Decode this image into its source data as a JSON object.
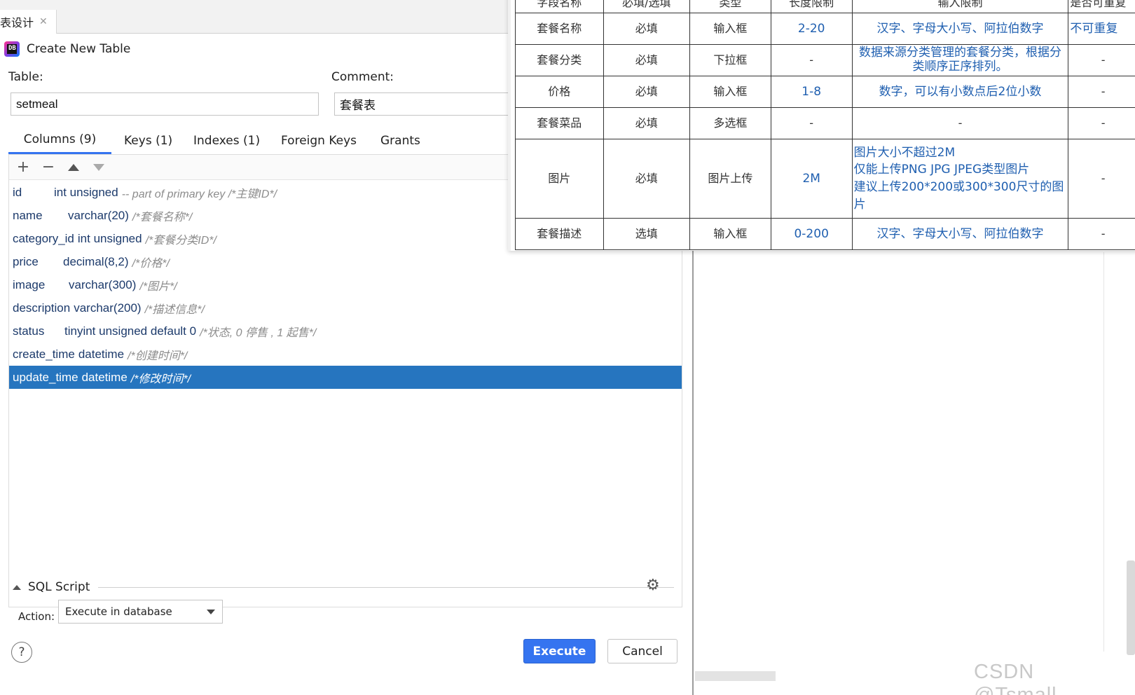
{
  "editor_tab": {
    "label": "表设计",
    "close": "✕"
  },
  "dialog": {
    "title": "Create New Table",
    "table_label": "Table:",
    "table_value": "setmeal",
    "comment_label": "Comment:",
    "comment_value": "套餐表",
    "tabs": [
      {
        "label": "Columns (9)",
        "active": true
      },
      {
        "label": "Keys (1)",
        "active": false
      },
      {
        "label": "Indexes (1)",
        "active": false
      },
      {
        "label": "Foreign Keys",
        "active": false
      },
      {
        "label": "Grants",
        "active": false
      }
    ],
    "toolbar": {
      "add": "+",
      "remove": "−"
    },
    "columns": [
      {
        "name": "id",
        "type": "int unsigned",
        "comment": "-- part of primary key /*主键ID*/"
      },
      {
        "name": "name",
        "type": "varchar(20)",
        "comment": "/*套餐名称*/"
      },
      {
        "name": "category_id",
        "type": "int unsigned",
        "comment": "/*套餐分类ID*/"
      },
      {
        "name": "price",
        "type": "decimal(8,2)",
        "comment": "/*价格*/"
      },
      {
        "name": "image",
        "type": "varchar(300)",
        "comment": "/*图片*/"
      },
      {
        "name": "description",
        "type": "varchar(200)",
        "comment": "/*描述信息*/"
      },
      {
        "name": "status",
        "type": "tinyint unsigned default 0",
        "comment": "/*状态, 0 停售 , 1 起售*/"
      },
      {
        "name": "create_time",
        "type": "datetime",
        "comment": "/*创建时间*/"
      },
      {
        "name": "update_time",
        "type": "datetime",
        "comment": "/*修改时间*/"
      }
    ],
    "selected_column": "update_time",
    "sql_script_label": "SQL Script",
    "action_label": "Action:",
    "action_value": "Execute in database",
    "help": "?",
    "execute_label": "Execute",
    "cancel_label": "Cancel"
  },
  "spec_table": {
    "headers": [
      "字段名称",
      "必填/选填",
      "类型",
      "长度限制",
      "输入限制",
      "是否可重复"
    ],
    "rows": [
      [
        "套餐名称",
        "必填",
        "输入框",
        "2-20",
        "汉字、字母大小写、阿拉伯数字",
        "不可重复"
      ],
      [
        "套餐分类",
        "必填",
        "下拉框",
        "-",
        "数据来源分类管理的套餐分类，根据分类顺序正序排列。",
        "-"
      ],
      [
        "价格",
        "必填",
        "输入框",
        "1-8",
        "数字，可以有小数点后2位小数",
        "-"
      ],
      [
        "套餐菜品",
        "必填",
        "多选框",
        "-",
        "-",
        "-"
      ],
      [
        "图片",
        "必填",
        "图片上传",
        "2M",
        "图片大小不超过2M\n仅能上传PNG JPG JPEG类型图片\n建议上传200*200或300*300尺寸的图片",
        "-"
      ],
      [
        "套餐描述",
        "选填",
        "输入框",
        "0-200",
        "汉字、字母大小写、阿拉伯数字",
        "-"
      ]
    ]
  },
  "watermark": "CSDN @Tsmall_",
  "colors": {
    "accent": "#3574f0",
    "selection": "#2675bf",
    "spec_blue": "#1f5fb0"
  }
}
